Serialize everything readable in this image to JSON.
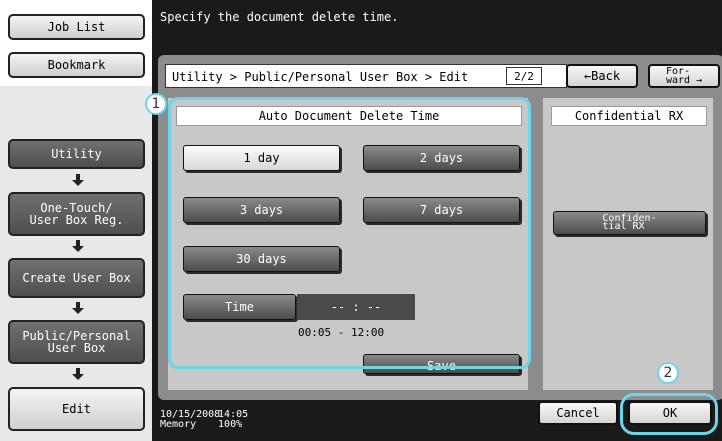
{
  "sidebar": {
    "job_list": "Job List",
    "bookmark": "Bookmark",
    "utility": "Utility",
    "one_touch": "One-Touch/\nUser Box Reg.",
    "create_user_box": "Create User Box",
    "public_personal": "Public/Personal\nUser Box",
    "edit": "Edit"
  },
  "header": {
    "message": "Specify the document delete time.",
    "breadcrumb": "Utility > Public/Personal User  Box > Edit",
    "page_indicator": "2/2",
    "back_label": "←Back",
    "forward_label": "For-\nward →"
  },
  "auto_delete": {
    "title": "Auto Document Delete Time",
    "options": [
      "1 day",
      "2 days",
      "3 days",
      "7 days",
      "30 days"
    ],
    "selected": "1 day",
    "time_label": "Time",
    "time_value": "-- : --",
    "range": "00:05  -  12:00",
    "save_label": "Save"
  },
  "confidential": {
    "title": "Confidential RX",
    "button_label": "Confiden-\ntial RX"
  },
  "status": {
    "date": "10/15/2008",
    "time": "14:05",
    "memory_label": "Memory",
    "memory_value": "100%"
  },
  "footer": {
    "cancel": "Cancel",
    "ok": "OK"
  },
  "callouts": {
    "one": "1",
    "two": "2"
  },
  "colors": {
    "callout": "#6fd4e8",
    "background_dark": "#1a1a1a",
    "panel": "#8c8c8c"
  }
}
